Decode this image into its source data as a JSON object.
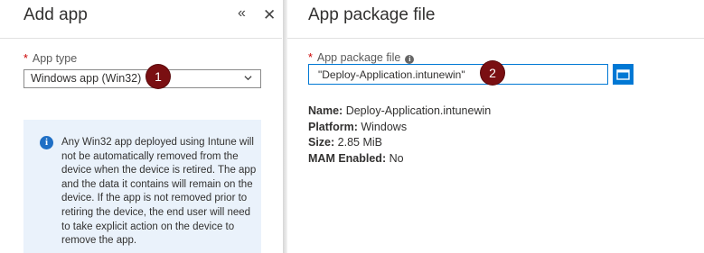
{
  "left_blade": {
    "title": "Add app",
    "collapse_glyph": "«",
    "close_glyph": "✕",
    "app_type": {
      "required_mark": "*",
      "label": "App type",
      "selected_value": "Windows app (Win32)"
    },
    "info": {
      "icon_glyph": "i",
      "text": "Any Win32 app deployed using Intune will not be automatically removed from the device when the device is retired. The app and the data it contains will remain on the device. If the app is not removed prior to retiring the device, the end user will need to take explicit action on the device to remove the app."
    }
  },
  "right_blade": {
    "title": "App package file",
    "package_field": {
      "required_mark": "*",
      "label": "App package file",
      "info_glyph": "i",
      "value": "\"Deploy-Application.intunewin\""
    },
    "details": [
      {
        "key": "Name:",
        "value": "Deploy-Application.intunewin"
      },
      {
        "key": "Platform:",
        "value": "Windows"
      },
      {
        "key": "Size:",
        "value": "2.85 MiB"
      },
      {
        "key": "MAM Enabled:",
        "value": "No"
      }
    ]
  },
  "callouts": [
    "1",
    "2"
  ],
  "colors": {
    "accent": "#0078d4",
    "callout": "#7a0f12",
    "info_bg": "#eaf2fb",
    "required": "#c00000"
  }
}
